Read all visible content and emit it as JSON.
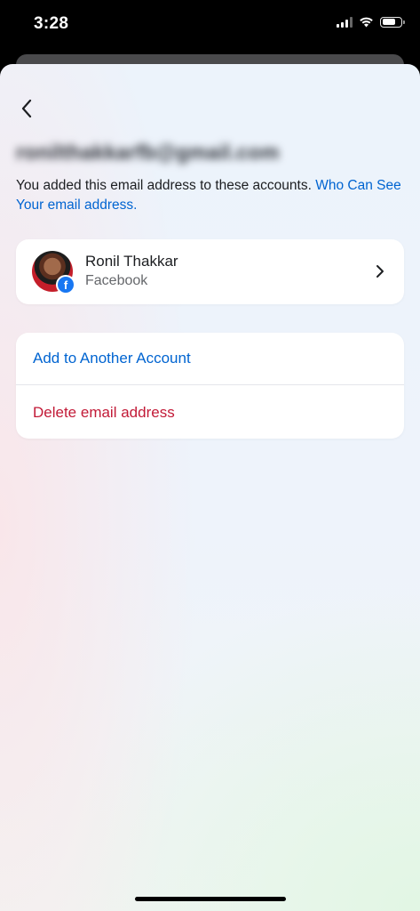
{
  "status_bar": {
    "time": "3:28"
  },
  "page": {
    "email_heading": "ronilthakkarfb@gmail.com",
    "description_text": "You added this email address to these accounts. ",
    "description_link": "Who Can See Your email address."
  },
  "account": {
    "name": "Ronil Thakkar",
    "platform": "Facebook",
    "badge_letter": "f"
  },
  "actions": {
    "add_label": "Add to Another Account",
    "delete_label": "Delete email address"
  },
  "colors": {
    "link_blue": "#0064d1",
    "danger_red": "#c21a37",
    "facebook_blue": "#1877f2"
  },
  "icons": [
    "back-chevron-icon",
    "chevron-right-icon",
    "facebook-badge-icon",
    "wifi-icon",
    "signal-icon",
    "battery-icon"
  ]
}
